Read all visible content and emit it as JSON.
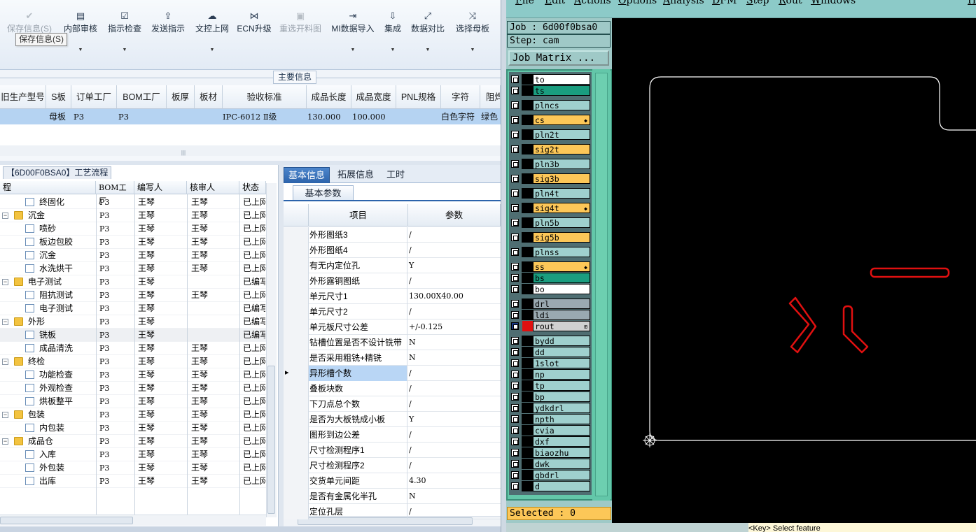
{
  "toolbar": {
    "buttons": [
      {
        "label": "保存信息(S)",
        "icon": "check-icon",
        "disabled": true
      },
      {
        "label": "内部审核",
        "icon": "printer-icon",
        "disabled": false
      },
      {
        "label": "指示检查",
        "icon": "checkbox-icon",
        "disabled": false
      },
      {
        "label": "发送指示",
        "icon": "upload-icon",
        "disabled": false
      },
      {
        "label": "文控上网",
        "icon": "cloud-upload-icon",
        "disabled": false
      },
      {
        "label": "ECN升级",
        "icon": "ecn-icon",
        "disabled": false
      },
      {
        "label": "重选开料图",
        "icon": "image-icon",
        "disabled": true
      },
      {
        "label": "MI数据导入",
        "icon": "import-icon",
        "disabled": false
      },
      {
        "label": "集成",
        "icon": "download-icon",
        "disabled": false
      },
      {
        "label": "数据对比",
        "icon": "compare-icon",
        "disabled": false
      },
      {
        "label": "选择母板",
        "icon": "shuffle-icon",
        "disabled": false
      }
    ],
    "tooltip": "保存信息(S)"
  },
  "main_info": {
    "title": "主要信息",
    "columns": [
      "旧生产型号",
      "S板",
      "订单工厂",
      "BOM工厂",
      "板厚",
      "板材",
      "验收标准",
      "成品长度",
      "成品宽度",
      "PNL规格",
      "字符",
      "阻焊"
    ],
    "row": [
      "",
      "母板",
      "P3",
      "P3",
      "",
      "",
      "IPC-6012 Ⅱ级",
      "130.000",
      "100.000",
      "",
      "白色字符",
      "绿色"
    ]
  },
  "process": {
    "title": "【6D00F0BSA0】工艺流程",
    "columns": [
      "程",
      "BOM工厂",
      "编写人",
      "核审人",
      "状态"
    ],
    "rows": [
      {
        "name": "终固化",
        "level": 2,
        "type": "doc",
        "bom": "P3",
        "writer": "王琴",
        "reviewer": "王琴",
        "status": "已上网"
      },
      {
        "name": "沉金",
        "level": 1,
        "type": "folder",
        "bom": "P3",
        "writer": "王琴",
        "reviewer": "王琴",
        "status": "已上网"
      },
      {
        "name": "喷砂",
        "level": 2,
        "type": "doc",
        "bom": "P3",
        "writer": "王琴",
        "reviewer": "王琴",
        "status": "已上网"
      },
      {
        "name": "板边包胶",
        "level": 2,
        "type": "doc",
        "bom": "P3",
        "writer": "王琴",
        "reviewer": "王琴",
        "status": "已上网"
      },
      {
        "name": "沉金",
        "level": 2,
        "type": "doc",
        "bom": "P3",
        "writer": "王琴",
        "reviewer": "王琴",
        "status": "已上网"
      },
      {
        "name": "水洗烘干",
        "level": 2,
        "type": "doc",
        "bom": "P3",
        "writer": "王琴",
        "reviewer": "王琴",
        "status": "已上网"
      },
      {
        "name": "电子测试",
        "level": 1,
        "type": "folder",
        "bom": "P3",
        "writer": "王琴",
        "reviewer": "",
        "status": "已编写"
      },
      {
        "name": "阻抗测试",
        "level": 2,
        "type": "doc",
        "bom": "P3",
        "writer": "王琴",
        "reviewer": "王琴",
        "status": "已上网"
      },
      {
        "name": "电子测试",
        "level": 2,
        "type": "doc",
        "bom": "P3",
        "writer": "王琴",
        "reviewer": "",
        "status": "已编写"
      },
      {
        "name": "外形",
        "level": 1,
        "type": "folder",
        "bom": "P3",
        "writer": "王琴",
        "reviewer": "",
        "status": "已编写"
      },
      {
        "name": "铣板",
        "level": 2,
        "type": "doc",
        "bom": "P3",
        "writer": "王琴",
        "reviewer": "",
        "status": "已编写",
        "selected": true
      },
      {
        "name": "成品清洗",
        "level": 2,
        "type": "doc",
        "bom": "P3",
        "writer": "王琴",
        "reviewer": "王琴",
        "status": "已上网"
      },
      {
        "name": "终检",
        "level": 1,
        "type": "folder",
        "bom": "P3",
        "writer": "王琴",
        "reviewer": "王琴",
        "status": "已上网"
      },
      {
        "name": "功能检查",
        "level": 2,
        "type": "doc",
        "bom": "P3",
        "writer": "王琴",
        "reviewer": "王琴",
        "status": "已上网"
      },
      {
        "name": "外观检查",
        "level": 2,
        "type": "doc",
        "bom": "P3",
        "writer": "王琴",
        "reviewer": "王琴",
        "status": "已上网"
      },
      {
        "name": "烘板整平",
        "level": 2,
        "type": "doc",
        "bom": "P3",
        "writer": "王琴",
        "reviewer": "王琴",
        "status": "已上网"
      },
      {
        "name": "包装",
        "level": 1,
        "type": "folder",
        "bom": "P3",
        "writer": "王琴",
        "reviewer": "王琴",
        "status": "已上网"
      },
      {
        "name": "内包装",
        "level": 2,
        "type": "doc",
        "bom": "P3",
        "writer": "王琴",
        "reviewer": "王琴",
        "status": "已上网"
      },
      {
        "name": "成品仓",
        "level": 1,
        "type": "folder",
        "bom": "P3",
        "writer": "王琴",
        "reviewer": "王琴",
        "status": "已上网"
      },
      {
        "name": "入库",
        "level": 2,
        "type": "doc",
        "bom": "P3",
        "writer": "王琴",
        "reviewer": "王琴",
        "status": "已上网"
      },
      {
        "name": "外包装",
        "level": 2,
        "type": "doc",
        "bom": "P3",
        "writer": "王琴",
        "reviewer": "王琴",
        "status": "已上网"
      },
      {
        "name": "出库",
        "level": 2,
        "type": "doc",
        "bom": "P3",
        "writer": "王琴",
        "reviewer": "王琴",
        "status": "已上网"
      }
    ]
  },
  "detail": {
    "tabs": [
      "基本信息",
      "拓展信息",
      "工时"
    ],
    "active_tab": 0,
    "subtab": "基本参数",
    "columns": [
      "项目",
      "参数"
    ],
    "rows": [
      {
        "key": "外形图纸3",
        "value": "/"
      },
      {
        "key": "外形图纸4",
        "value": "/"
      },
      {
        "key": "有无内定位孔",
        "value": "Y"
      },
      {
        "key": "外形露铜图纸",
        "value": "/"
      },
      {
        "key": "单元尺寸1",
        "value": "130.00X40.00"
      },
      {
        "key": "单元尺寸2",
        "value": "/"
      },
      {
        "key": "单元板尺寸公差",
        "value": "+/-0.125"
      },
      {
        "key": "钻槽位置是否不设计铣带",
        "value": "N"
      },
      {
        "key": "是否采用粗铣+精铣",
        "value": "N"
      },
      {
        "key": "异形槽个数",
        "value": "/",
        "current": true
      },
      {
        "key": "叠板块数",
        "value": "/"
      },
      {
        "key": "下刀点总个数",
        "value": "/"
      },
      {
        "key": "是否为大板铣成小板",
        "value": "Y"
      },
      {
        "key": "图形到边公差",
        "value": "/"
      },
      {
        "key": "尺寸检测程序1",
        "value": "/"
      },
      {
        "key": "尺寸检测程序2",
        "value": "/"
      },
      {
        "key": "交货单元间距",
        "value": "4.30"
      },
      {
        "key": "是否有金属化半孔",
        "value": "N"
      },
      {
        "key": "定位孔层",
        "value": "/"
      }
    ]
  },
  "cam": {
    "menu": [
      {
        "label": "File",
        "u": "F"
      },
      {
        "label": "Edit",
        "u": "E"
      },
      {
        "label": "Actions",
        "u": "A"
      },
      {
        "label": "Options",
        "u": "O"
      },
      {
        "label": "Analysis",
        "u": "A"
      },
      {
        "label": "DFM",
        "u": "D"
      },
      {
        "label": "Step",
        "u": "S"
      },
      {
        "label": "Rout",
        "u": "R"
      },
      {
        "label": "Windows",
        "u": "W"
      }
    ],
    "menu_help": "H",
    "job": "Job : 6d00f0bsa0",
    "step": "Step: cam",
    "job_matrix": "Job Matrix ...",
    "layers": [
      {
        "name": "to",
        "color": "#ffffff"
      },
      {
        "name": "ts",
        "color": "#1a9d7f"
      },
      {
        "name": "plncs",
        "color": "#9fd0ce"
      },
      {
        "name": "cs",
        "color": "#fcc758",
        "mark": true
      },
      {
        "name": "pln2t",
        "color": "#9fd0ce"
      },
      {
        "name": "sig2t",
        "color": "#fcc758"
      },
      {
        "name": "pln3b",
        "color": "#9fd0ce"
      },
      {
        "name": "sig3b",
        "color": "#fcc758"
      },
      {
        "name": "pln4t",
        "color": "#9fd0ce"
      },
      {
        "name": "sig4t",
        "color": "#fcc758",
        "mark": true
      },
      {
        "name": "pln5b",
        "color": "#9fd0ce"
      },
      {
        "name": "sig5b",
        "color": "#fcc758"
      },
      {
        "name": "plnss",
        "color": "#9fd0ce"
      },
      {
        "name": "ss",
        "color": "#fcc758",
        "mark": true
      },
      {
        "name": "bs",
        "color": "#1a9d7f"
      },
      {
        "name": "bo",
        "color": "#ffffff"
      },
      {
        "name": "drl",
        "color": "#9aa9b1"
      },
      {
        "name": "ldi",
        "color": "#9aa9b1"
      },
      {
        "name": "rout",
        "color": "#d0d0d0",
        "active": true
      },
      {
        "name": "bydd",
        "color": "#9fd0ce"
      },
      {
        "name": "dd",
        "color": "#9fd0ce"
      },
      {
        "name": "1slot",
        "color": "#9fd0ce"
      },
      {
        "name": "np",
        "color": "#9fd0ce"
      },
      {
        "name": "tp",
        "color": "#9fd0ce"
      },
      {
        "name": "bp",
        "color": "#9fd0ce"
      },
      {
        "name": "ydkdrl",
        "color": "#9fd0ce"
      },
      {
        "name": "npth",
        "color": "#9fd0ce"
      },
      {
        "name": "cvia",
        "color": "#9fd0ce"
      },
      {
        "name": "dxf",
        "color": "#9fd0ce"
      },
      {
        "name": "biaozhu",
        "color": "#9fd0ce"
      },
      {
        "name": "dwk",
        "color": "#9fd0ce"
      },
      {
        "name": "gbdrl",
        "color": "#9fd0ce"
      },
      {
        "name": "d",
        "color": "#9fd0ce"
      }
    ],
    "selected": "Selected : 0",
    "status_tail": "<Key> Select feature",
    "accent_red": "#e01010"
  }
}
